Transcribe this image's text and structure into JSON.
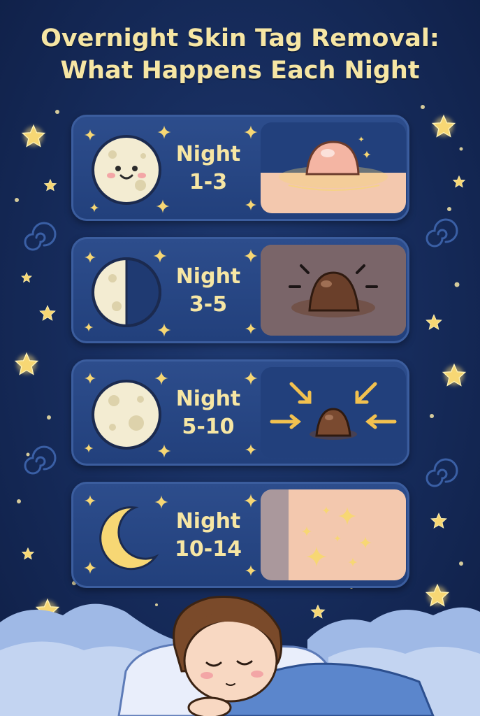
{
  "title": {
    "line1": "Overnight Skin Tag Removal:",
    "line2": "What Happens Each Night"
  },
  "stages": [
    {
      "label_line1": "Night",
      "label_line2": "1-3",
      "moon": "full-moon-face",
      "stage_icon": "raised-skin-tag-icon"
    },
    {
      "label_line1": "Night",
      "label_line2": "3-5",
      "moon": "half-moon",
      "stage_icon": "darkening-skin-tag-icon"
    },
    {
      "label_line1": "Night",
      "label_line2": "5-10",
      "moon": "full-moon",
      "stage_icon": "shrinking-skin-tag-icon"
    },
    {
      "label_line1": "Night",
      "label_line2": "10-14",
      "moon": "crescent-moon",
      "stage_icon": "clear-skin-sparkle-icon"
    }
  ],
  "colors": {
    "background": "#172d5e",
    "title": "#f6e6a4",
    "star": "#f7d774",
    "skin": "#f3c8ae",
    "tag_dark": "#6a3f2a"
  }
}
